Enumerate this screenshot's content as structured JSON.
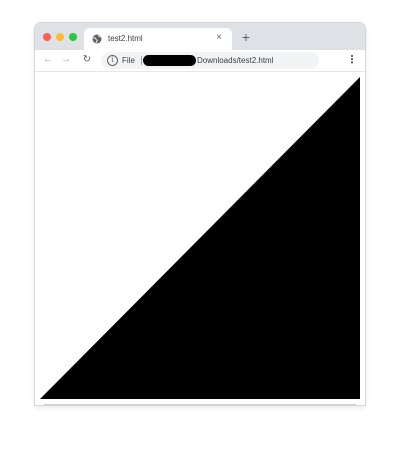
{
  "browser": {
    "tab": {
      "title": "test2.html",
      "close_glyph": "×",
      "favicon": "globe-icon"
    },
    "new_tab_glyph": "+",
    "toolbar": {
      "back_glyph": "←",
      "forward_glyph": "→",
      "reload_glyph": "↻",
      "info_glyph": "i",
      "scheme_label": "File",
      "url_path": "Downloads/test2.html",
      "star_glyph": "☆",
      "menu_glyph": "⋮"
    },
    "colors": {
      "tabbar_bg": "#dee1e6",
      "traffic_red": "#ff5f57",
      "traffic_yellow": "#febc2e",
      "traffic_green": "#28c840",
      "triangle_fill": "#000000"
    }
  },
  "page": {
    "content": "black right triangle filling lower-right half of viewport"
  }
}
